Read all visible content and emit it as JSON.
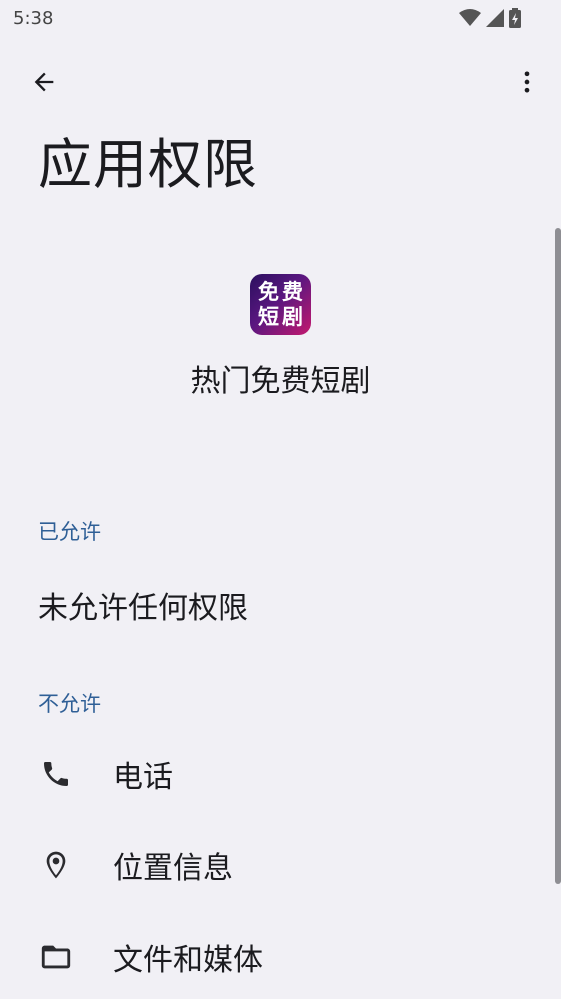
{
  "status_bar": {
    "time": "5:38",
    "icons": [
      "wifi-icon",
      "signal-icon",
      "battery-icon"
    ]
  },
  "app_bar": {
    "back_icon": "arrow-back-icon",
    "more_icon": "more-vert-icon"
  },
  "page": {
    "title": "应用权限"
  },
  "app": {
    "name": "热门免费短剧",
    "icon_chars": [
      "免",
      "费",
      "短",
      "剧"
    ]
  },
  "sections": {
    "allowed": {
      "header": "已允许",
      "empty_text": "未允许任何权限"
    },
    "denied": {
      "header": "不允许",
      "items": [
        {
          "label": "电话",
          "icon": "phone-icon"
        },
        {
          "label": "位置信息",
          "icon": "location-icon"
        },
        {
          "label": "文件和媒体",
          "icon": "folder-icon"
        }
      ]
    }
  },
  "colors": {
    "background": "#f1f0f5",
    "section_header": "#2f5f96",
    "text": "#1b1b1f"
  }
}
